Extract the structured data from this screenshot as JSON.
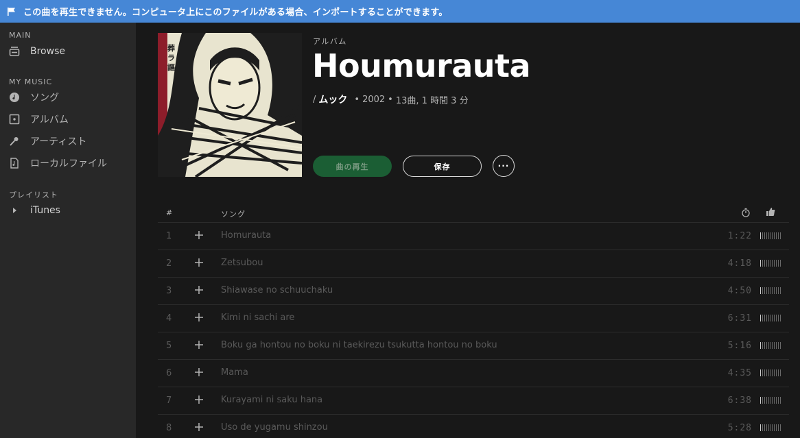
{
  "banner": {
    "message": "この曲を再生できません。コンピュータ上にこのファイルがある場合、インポートすることができます。",
    "icon": "flag-icon"
  },
  "sidebar": {
    "main_heading": "MAIN",
    "main_items": [
      {
        "label": "Browse",
        "icon": "radio-icon"
      }
    ],
    "my_music_heading": "MY MUSIC",
    "my_music_items": [
      {
        "label": "ソング",
        "icon": "music-note-circle-icon"
      },
      {
        "label": "アルバム",
        "icon": "album-icon"
      },
      {
        "label": "アーティスト",
        "icon": "microphone-icon"
      },
      {
        "label": "ローカルファイル",
        "icon": "file-music-icon"
      }
    ],
    "playlists_heading": "プレイリスト",
    "playlists": [
      {
        "label": "iTunes",
        "icon": "triangle-right-icon"
      }
    ]
  },
  "album": {
    "type_label": "アルバム",
    "title": "Houmurauta",
    "artist_prefix": "/",
    "artist": "ムック",
    "year": "2002",
    "summary": "13曲, 1 時間 3 分",
    "cover_text": "葬ラ謳"
  },
  "actions": {
    "play_label": "曲の再生",
    "save_label": "保存",
    "more_label": "···"
  },
  "table": {
    "col_number": "#",
    "col_song": "ソング",
    "duration_icon": "stopwatch-icon",
    "popularity_icon": "thumbs-up-icon",
    "rows": [
      {
        "num": "1",
        "name": "Homurauta",
        "duration": "1:22",
        "popularity": 0.1
      },
      {
        "num": "2",
        "name": "Zetsubou",
        "duration": "4:18",
        "popularity": 0.1
      },
      {
        "num": "3",
        "name": "Shiawase no schuuchaku",
        "duration": "4:50",
        "popularity": 0.1
      },
      {
        "num": "4",
        "name": "Kimi ni sachi are",
        "duration": "6:31",
        "popularity": 0.1
      },
      {
        "num": "5",
        "name": "Boku ga hontou no boku ni taekirezu tsukutta hontou no boku",
        "duration": "5:16",
        "popularity": 0.1
      },
      {
        "num": "6",
        "name": "Mama",
        "duration": "4:35",
        "popularity": 0.1
      },
      {
        "num": "7",
        "name": "Kurayami ni saku hana",
        "duration": "6:38",
        "popularity": 0.1
      },
      {
        "num": "8",
        "name": "Uso de yugamu shinzou",
        "duration": "5:28",
        "popularity": 0.1
      }
    ]
  },
  "colors": {
    "banner": "#4687d6",
    "sidebar": "#282828",
    "main": "#181818",
    "play_button": "#1b5e34"
  }
}
